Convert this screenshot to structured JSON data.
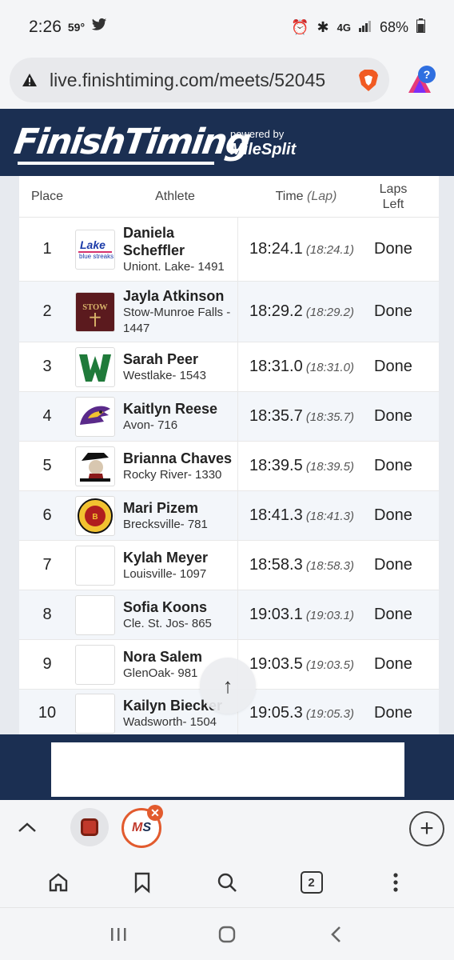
{
  "status_bar": {
    "time": "2:26",
    "temp": "59°",
    "battery": "68%"
  },
  "browser": {
    "url": "live.finishtiming.com/meets/52045",
    "tabs_count": "2"
  },
  "site": {
    "logo": "FinishTiming",
    "powered_by": "powered by",
    "partner": "MileSplit"
  },
  "table": {
    "headers": {
      "place": "Place",
      "athlete": "Athlete",
      "time": "Time",
      "time_lap": "(Lap)",
      "laps_left_1": "Laps",
      "laps_left_2": "Left"
    },
    "rows": [
      {
        "place": "1",
        "name": "Daniela Scheffler",
        "team": "Uniont. Lake- 1491",
        "time": "18:24.1",
        "lap": "(18:24.1)",
        "laps": "Done",
        "logo": "lake-blue-streaks-logo"
      },
      {
        "place": "2",
        "name": "Jayla Atkinson",
        "team": "Stow-Munroe Falls - 1447",
        "time": "18:29.2",
        "lap": "(18:29.2)",
        "laps": "Done",
        "logo": "stow-logo"
      },
      {
        "place": "3",
        "name": "Sarah Peer",
        "team": "Westlake- 1543",
        "time": "18:31.0",
        "lap": "(18:31.0)",
        "laps": "Done",
        "logo": "westlake-logo"
      },
      {
        "place": "4",
        "name": "Kaitlyn Reese",
        "team": "Avon- 716",
        "time": "18:35.7",
        "lap": "(18:35.7)",
        "laps": "Done",
        "logo": "avon-eagle-logo"
      },
      {
        "place": "5",
        "name": "Brianna Chaves",
        "team": "Rocky River- 1330",
        "time": "18:39.5",
        "lap": "(18:39.5)",
        "laps": "Done",
        "logo": "rocky-river-pirate-logo"
      },
      {
        "place": "6",
        "name": "Mari Pizem",
        "team": "Brecksville- 781",
        "time": "18:41.3",
        "lap": "(18:41.3)",
        "laps": "Done",
        "logo": "brecksville-logo"
      },
      {
        "place": "7",
        "name": "Kylah Meyer",
        "team": "Louisville- 1097",
        "time": "18:58.3",
        "lap": "(18:58.3)",
        "laps": "Done",
        "logo": "blank-logo"
      },
      {
        "place": "8",
        "name": "Sofia Koons",
        "team": "Cle. St. Jos- 865",
        "time": "19:03.1",
        "lap": "(19:03.1)",
        "laps": "Done",
        "logo": "blank-logo"
      },
      {
        "place": "9",
        "name": "Nora Salem",
        "team": "GlenOak- 981",
        "time": "19:03.5",
        "lap": "(19:03.5)",
        "laps": "Done",
        "logo": "blank-logo"
      },
      {
        "place": "10",
        "name": "Kailyn Biecker",
        "team": "Wadsworth- 1504",
        "time": "19:05.3",
        "lap": "(19:05.3)",
        "laps": "Done",
        "logo": "blank-logo"
      }
    ]
  },
  "colors": {
    "brand_navy": "#1b2f52",
    "milesplit_orange": "#e25b2e"
  }
}
